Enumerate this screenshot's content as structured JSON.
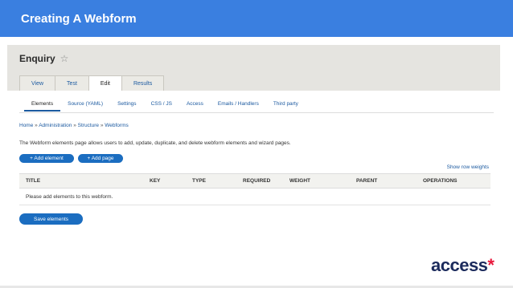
{
  "slide": {
    "title": "Creating A Webform"
  },
  "page": {
    "title": "Enquiry"
  },
  "primary_tabs": [
    {
      "label": "View"
    },
    {
      "label": "Test"
    },
    {
      "label": "Edit"
    },
    {
      "label": "Results"
    }
  ],
  "primary_active": "Edit",
  "secondary_tabs": [
    {
      "label": "Elements"
    },
    {
      "label": "Source (YAML)"
    },
    {
      "label": "Settings"
    },
    {
      "label": "CSS / JS"
    },
    {
      "label": "Access"
    },
    {
      "label": "Emails / Handlers"
    },
    {
      "label": "Third party"
    }
  ],
  "secondary_active": "Elements",
  "breadcrumb": [
    "Home",
    "Administration",
    "Structure",
    "Webforms"
  ],
  "breadcrumb_separator": "»",
  "description": "The Webform elements page allows users to add, update, duplicate, and delete webform elements and wizard pages.",
  "buttons": {
    "add_element": "+ Add element",
    "add_page": "+ Add page",
    "save_elements": "Save elements"
  },
  "show_row_weights": "Show row weights",
  "table": {
    "columns": [
      "TITLE",
      "KEY",
      "TYPE",
      "REQUIRED",
      "WEIGHT",
      "PARENT",
      "OPERATIONS"
    ],
    "empty_message": "Please add elements to this webform."
  },
  "brand": {
    "name": "access",
    "mark": "*"
  },
  "colors": {
    "header_blue": "#3a7fe0",
    "button_blue": "#1b6dc0",
    "link_blue": "#1c5aa0",
    "brand_navy": "#1b2a5c",
    "brand_red": "#e8173b"
  }
}
